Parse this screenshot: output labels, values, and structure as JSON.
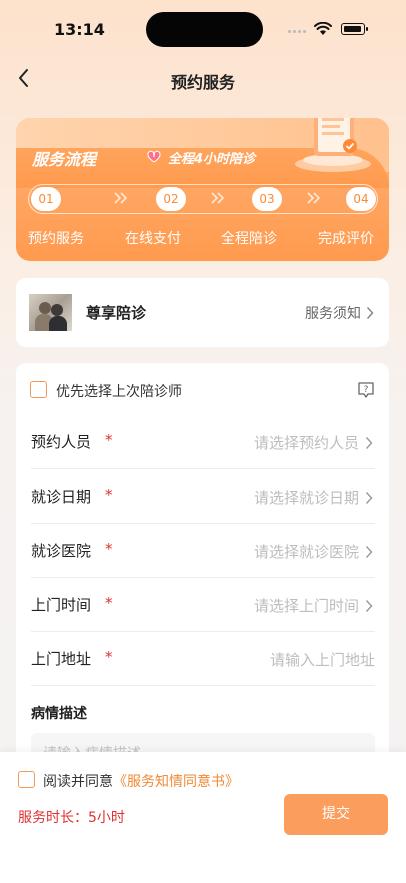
{
  "status_bar": {
    "time": "13:14"
  },
  "nav": {
    "title": "预约服务"
  },
  "process": {
    "title": "服务流程",
    "tag": "全程4小时陪诊",
    "steps": [
      {
        "num": "01",
        "label": "预约服务"
      },
      {
        "num": "02",
        "label": "在线支付"
      },
      {
        "num": "03",
        "label": "全程陪诊"
      },
      {
        "num": "04",
        "label": "完成评价"
      }
    ]
  },
  "service": {
    "name": "尊享陪诊",
    "notice_label": "服务须知"
  },
  "form": {
    "prefer_last": {
      "label": "优先选择上次陪诊师",
      "checked": false
    },
    "required_mark": "*",
    "fields": [
      {
        "label": "预约人员",
        "placeholder": "请选择预约人员"
      },
      {
        "label": "就诊日期",
        "placeholder": "请选择就诊日期"
      },
      {
        "label": "就诊医院",
        "placeholder": "请选择就诊医院"
      },
      {
        "label": "上门时间",
        "placeholder": "请选择上门时间"
      },
      {
        "label": "上门地址",
        "placeholder": "请输入上门地址"
      }
    ],
    "description": {
      "label": "病情描述",
      "placeholder": "请输入病情描述"
    }
  },
  "bottom": {
    "agree_prefix": "阅读并同意",
    "agree_link": "《服务知情同意书》",
    "duration": "服务时长：5小时",
    "submit_label": "提交"
  },
  "colors": {
    "accent": "#ff9a4e",
    "required": "#e03232",
    "submit": "#fb9d5d"
  }
}
